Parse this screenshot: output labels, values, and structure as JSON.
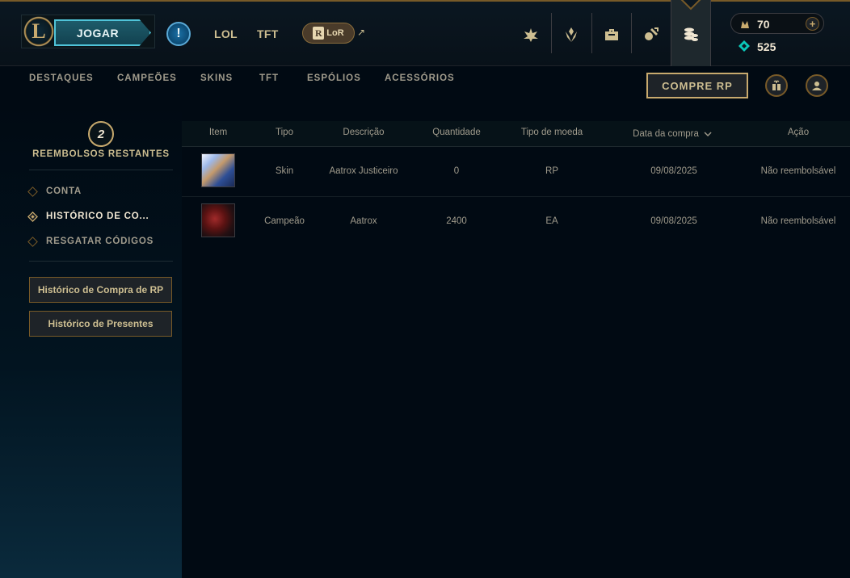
{
  "topbar": {
    "logo_letter": "L",
    "play_label": "JOGAR",
    "alert_symbol": "!",
    "games": [
      "LOL",
      "TFT"
    ],
    "lor_badge": "R",
    "lor_label": "LoR",
    "external_symbol": "↗",
    "icons": [
      "clash-icon",
      "profile-icon",
      "collection-icon",
      "loot-icon",
      "store-icon"
    ],
    "rp_value": "70",
    "add_symbol": "+",
    "be_value": "525"
  },
  "subnav": {
    "items": [
      "DESTAQUES",
      "CAMPEÕES",
      "SKINS",
      "TFT",
      "ESPÓLIOS",
      "ACESSÓRIOS"
    ],
    "buy_rp": "COMPRE RP"
  },
  "sidebar": {
    "refunds_count": "2",
    "refunds_label": "REEMBOLSOS RESTANTES",
    "items": [
      {
        "label": "CONTA",
        "active": false
      },
      {
        "label": "HISTÓRICO DE CO...",
        "active": true
      },
      {
        "label": "RESGATAR CÓDIGOS",
        "active": false
      }
    ],
    "buttons": [
      "Histórico de Compra de RP",
      "Histórico de Presentes"
    ]
  },
  "table": {
    "headers": [
      "Item",
      "Tipo",
      "Descrição",
      "Quantidade",
      "Tipo de moeda",
      "Data da compra",
      "Ação"
    ],
    "rows": [
      {
        "tipo": "Skin",
        "descricao": "Aatrox Justiceiro",
        "quantidade": "0",
        "moeda": "RP",
        "data": "09/08/2025",
        "acao": "Não reembolsável"
      },
      {
        "tipo": "Campeão",
        "descricao": "Aatrox",
        "quantidade": "2400",
        "moeda": "EA",
        "data": "09/08/2025",
        "acao": "Não reembolsável"
      }
    ]
  },
  "colors": {
    "gold": "#c8aa6e",
    "gold_dark": "#785a28",
    "text": "#a09b8c",
    "text_bright": "#f0e6d2",
    "background": "#010a13",
    "play_accent": "#4fc3d8",
    "blue_essence": "#0ac8b9"
  }
}
